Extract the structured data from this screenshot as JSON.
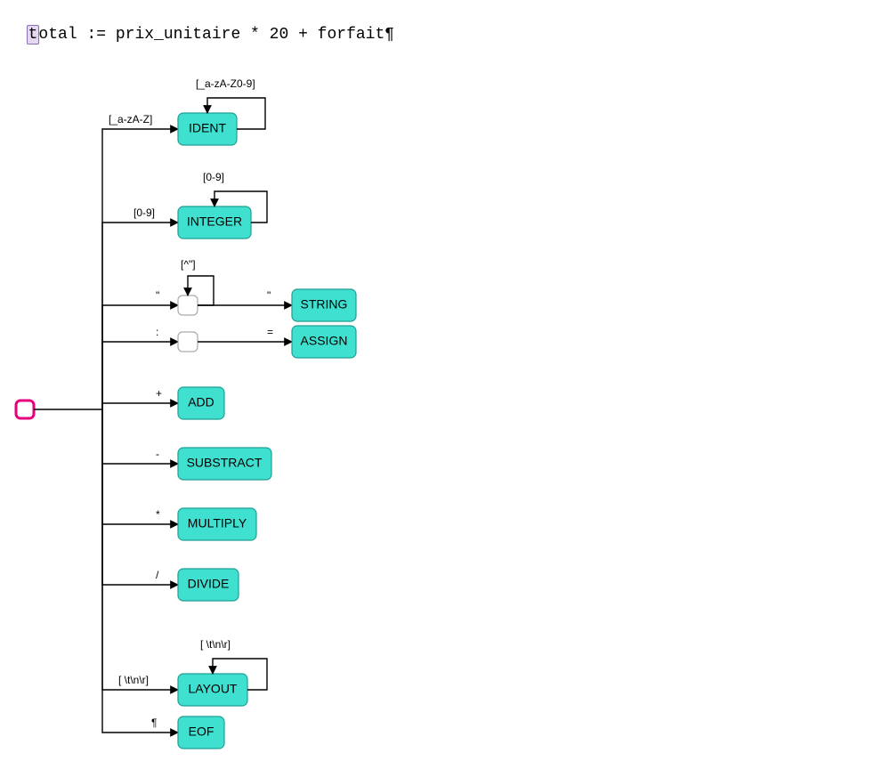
{
  "code": {
    "highlighted_char": "t",
    "rest": "otal := prix_unitaire * 20 + forfait¶"
  },
  "diagram": {
    "start_label": "",
    "branches": [
      {
        "edge": "[_a-zA-Z]",
        "node": "IDENT",
        "loop": "[_a-zA-Z0-9]"
      },
      {
        "edge": "[0-9]",
        "node": "INTEGER",
        "loop": "[0-9]"
      },
      {
        "edge": "\"",
        "mid_node": "",
        "mid_loop": "[^\"]",
        "edge2": "\"",
        "node": "STRING"
      },
      {
        "edge": ":",
        "mid_node": "",
        "edge2": "=",
        "node": "ASSIGN"
      },
      {
        "edge": "+",
        "node": "ADD"
      },
      {
        "edge": "-",
        "node": "SUBSTRACT"
      },
      {
        "edge": "*",
        "node": "MULTIPLY"
      },
      {
        "edge": "/",
        "node": "DIVIDE"
      },
      {
        "edge": "[ \\t\\n\\r]",
        "node": "LAYOUT",
        "loop": "[ \\t\\n\\r]"
      },
      {
        "edge": "¶",
        "node": "EOF"
      }
    ]
  }
}
